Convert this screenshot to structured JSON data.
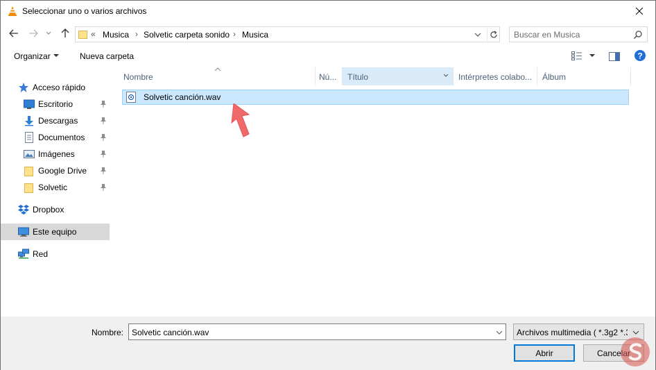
{
  "window": {
    "title": "Seleccionar uno o varios archivos"
  },
  "nav": {
    "breadcrumb_overflow": "«",
    "breadcrumbs": [
      "Musica",
      "Solvetic carpeta sonido",
      "Musica"
    ],
    "search_placeholder": "Buscar en Musica"
  },
  "toolbar": {
    "organize_label": "Organizar",
    "new_folder_label": "Nueva carpeta"
  },
  "sidebar": {
    "items": [
      {
        "label": "Acceso rápido",
        "icon": "star-icon"
      },
      {
        "label": "Escritorio",
        "icon": "desktop-icon"
      },
      {
        "label": "Descargas",
        "icon": "download-icon"
      },
      {
        "label": "Documentos",
        "icon": "document-icon"
      },
      {
        "label": "Imágenes",
        "icon": "pictures-icon"
      },
      {
        "label": "Google Drive",
        "icon": "folder-icon"
      },
      {
        "label": "Solvetic",
        "icon": "folder-icon"
      },
      {
        "label": "Dropbox",
        "icon": "dropbox-icon"
      },
      {
        "label": "Este equipo",
        "icon": "computer-icon"
      },
      {
        "label": "Red",
        "icon": "network-icon"
      }
    ]
  },
  "columns": [
    "Nombre",
    "Nú...",
    "Título",
    "Intérpretes colabo...",
    "Álbum"
  ],
  "files": [
    {
      "name": "Solvetic canción.wav",
      "icon": "audio-file-icon"
    }
  ],
  "footer": {
    "name_label": "Nombre:",
    "name_value": "Solvetic canción.wav",
    "type_value": "Archivos multimedia ( *.3g2 *.3",
    "open_label": "Abrir",
    "cancel_label": "Cancelar"
  },
  "colors": {
    "selection": "#cce8ff",
    "accent": "#0078d7",
    "annotation_arrow": "#f16a6a"
  }
}
